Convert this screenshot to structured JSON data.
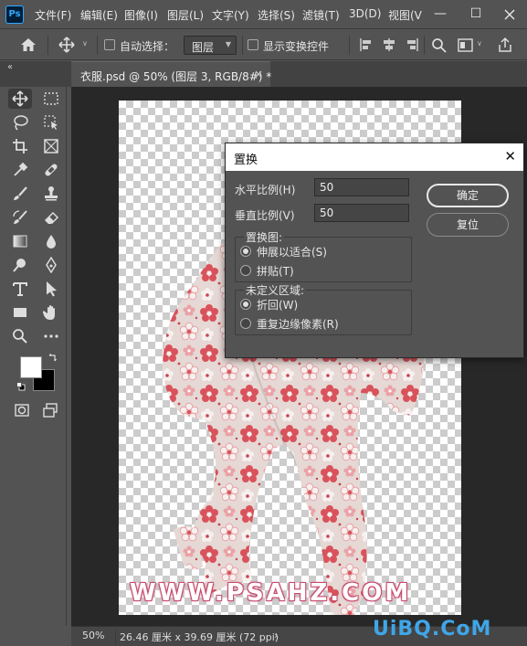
{
  "app": {
    "logo": "Ps"
  },
  "menu": {
    "items": [
      "文件(F)",
      "编辑(E)",
      "图像(I)",
      "图层(L)",
      "文字(Y)",
      "选择(S)",
      "滤镜(T)",
      "3D(D)",
      "视图(V"
    ],
    "minimize": "—",
    "maximize": "☐"
  },
  "options": {
    "auto_select_label": "自动选择：",
    "layer_select_value": "图层",
    "show_transform_label": "显示变换控件"
  },
  "tabs": [
    {
      "label": "衣服.psd @ 50% (图层 3, RGB/8#) *",
      "close": "×"
    }
  ],
  "panel_toggle": "‹‹",
  "canvas": {
    "watermark": "WWW.PSAHZ.COM"
  },
  "status": {
    "zoom": "50%",
    "doc_size": "26.46 厘米 x 39.69 厘米 (72 ppi)",
    "arrow": "›"
  },
  "site_logo": "UiBQ.CoM",
  "dialog": {
    "title": "置换",
    "close": "✕",
    "horizontal_scale_label": "水平比例(H)",
    "horizontal_scale_value": "50",
    "vertical_scale_label": "垂直比例(V)",
    "vertical_scale_value": "50",
    "ok": "确定",
    "reset": "复位",
    "displacement_map": {
      "title": "置换图:",
      "options": [
        {
          "label": "伸展以适合(S)",
          "selected": true
        },
        {
          "label": "拼贴(T)",
          "selected": false
        }
      ]
    },
    "undefined_areas": {
      "title": "未定义区域:",
      "options": [
        {
          "label": "折回(W)",
          "selected": true
        },
        {
          "label": "重复边缘像素(R)",
          "selected": false
        }
      ]
    }
  },
  "colors": {
    "foreground": "#ffffff",
    "background": "#000000",
    "accent": "#31a8ff"
  }
}
